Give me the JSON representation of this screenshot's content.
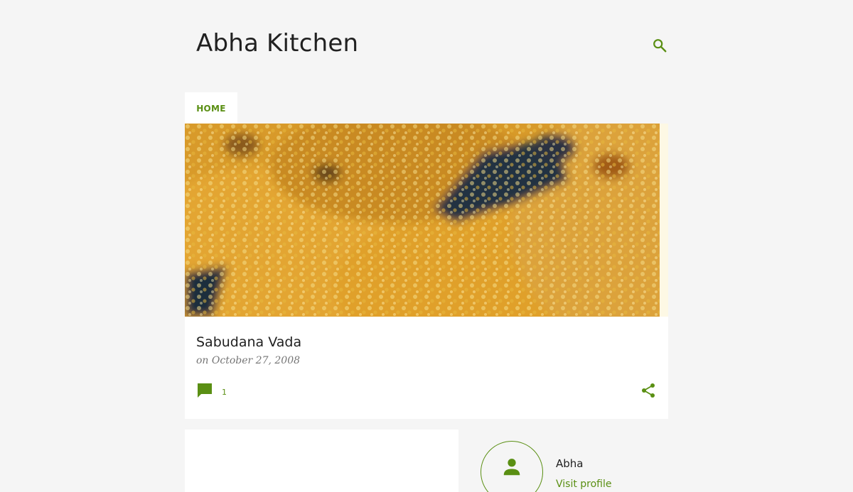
{
  "header": {
    "blog_title": "Abha Kitchen",
    "search_icon": "search-icon"
  },
  "nav": {
    "tabs": [
      {
        "label": "HOME"
      }
    ]
  },
  "post": {
    "title": "Sabudana Vada",
    "date": "on October 27, 2008",
    "comment_count": "1",
    "comment_icon": "comment-icon",
    "share_icon": "share-icon"
  },
  "profile": {
    "name": "Abha",
    "link_label": "Visit profile",
    "avatar_icon": "person-icon"
  },
  "colors": {
    "accent": "#5a8f13",
    "background": "#f5f5f5",
    "card": "#ffffff",
    "text": "#212121",
    "muted": "#757575"
  }
}
